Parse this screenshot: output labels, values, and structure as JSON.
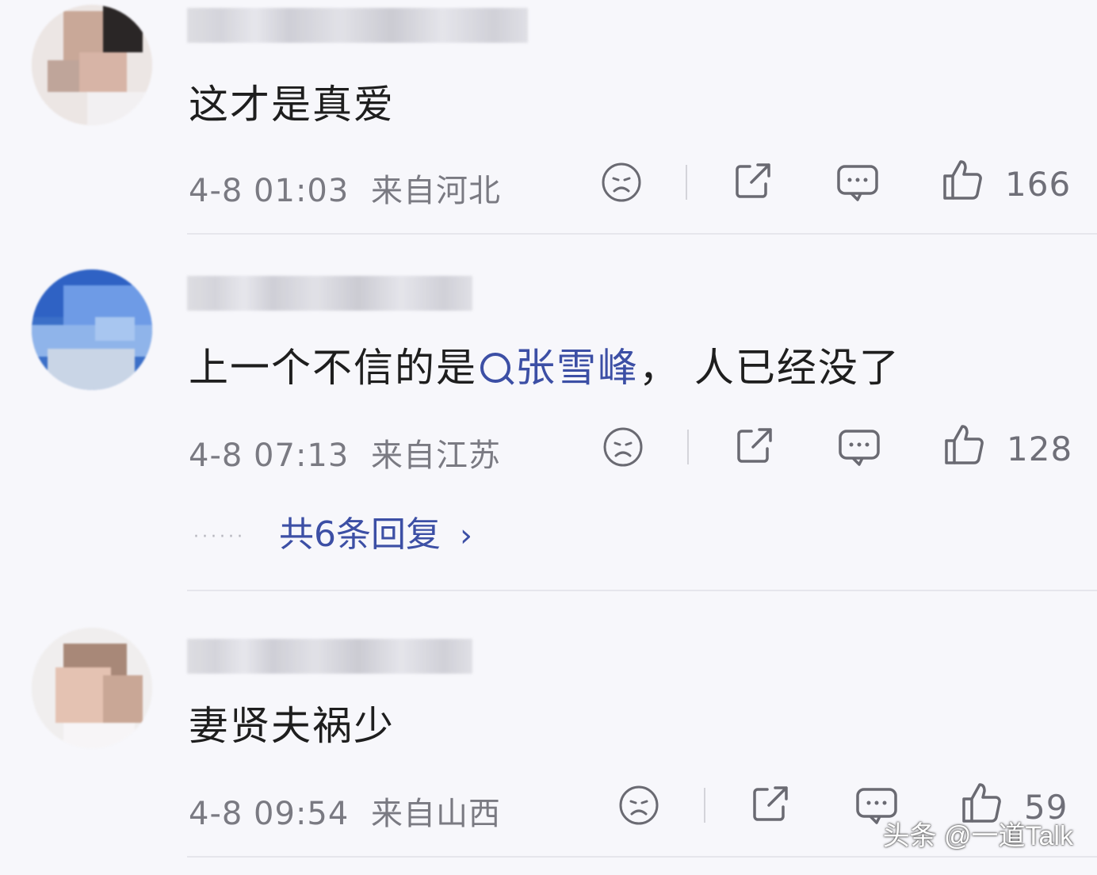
{
  "comments": [
    {
      "text": "这才是真爱",
      "time": "4-8 01:03",
      "location": "来自河北",
      "likes": "166"
    },
    {
      "text_before": "上一个不信的是",
      "topic": "张雪峰",
      "text_after": "，  人已经没了",
      "time": "4-8 07:13",
      "location": "来自江苏",
      "likes": "128",
      "replies_label": "共6条回复",
      "replies_dots": "······"
    },
    {
      "text": "妻贤夫祸少",
      "time": "4-8 09:54",
      "location": "来自山西",
      "likes": "59"
    }
  ],
  "icons": {
    "dislike": "sad-face-icon",
    "share": "share-icon",
    "reply": "comment-bubble-icon",
    "like": "thumbs-up-icon",
    "topic": "search-icon",
    "more": "chevron-right-icon"
  },
  "colors": {
    "topic": "#3c4fa5",
    "meta": "#7a7a82",
    "background": "#f7f7fb"
  },
  "watermark": "头条 @一道Talk"
}
